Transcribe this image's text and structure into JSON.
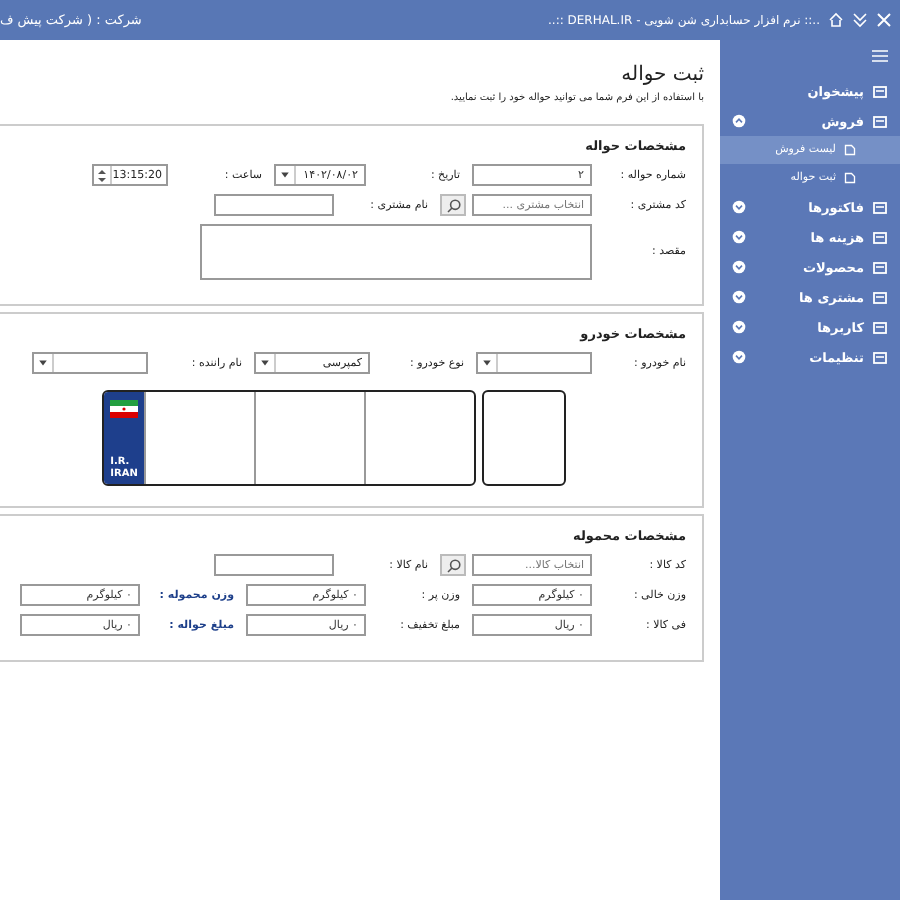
{
  "title_bar": {
    "app_title": "..:: نرم افزار حسابداری شن شویی - DERHAL.IR ::..",
    "company": "شرکت : ( شرکت پیش ف"
  },
  "page": {
    "title": "ثبت حواله",
    "subtitle": "با استفاده از این فرم شما می توانید حواله خود را ثبت نمایید."
  },
  "sections": [
    {
      "title": "مشخصات حواله",
      "rows": [
        [
          {
            "label": "شماره حواله :",
            "kind": "input",
            "value": "۲",
            "highlighted": false
          },
          {
            "label": "تاریخ :",
            "kind": "date",
            "value": "۱۴۰۲/۰۸/۰۲",
            "highlighted": false
          },
          {
            "label": "ساعت :",
            "kind": "time",
            "value": "13:15:20",
            "highlighted": false
          }
        ],
        [
          {
            "label": "کد مشتری :",
            "kind": "lookup",
            "placeholder": "انتخاب مشتری ...",
            "highlighted": false
          },
          {
            "label": "نام مشتری :",
            "kind": "input",
            "highlighted": false
          }
        ],
        [
          {
            "label": "مقصد :",
            "kind": "textarea",
            "highlighted": false
          }
        ]
      ]
    },
    {
      "title": "مشخصات خودرو",
      "rows": [
        [
          {
            "label": "نام خودرو :",
            "kind": "select",
            "highlighted": false
          },
          {
            "label": "نوع خودرو :",
            "kind": "select",
            "value": "کمپرسی",
            "highlighted": false
          },
          {
            "label": "نام راننده :",
            "kind": "select",
            "highlighted": false
          }
        ]
      ],
      "plate": {
        "country_lines": [
          "I.R.",
          "IRAN"
        ]
      }
    },
    {
      "title": "مشخصات محموله",
      "rows": [
        [
          {
            "label": "کد کالا :",
            "kind": "lookup",
            "placeholder": "انتخاب کالا...",
            "highlighted": false
          },
          {
            "label": "نام کالا :",
            "kind": "input",
            "highlighted": false
          }
        ],
        [
          {
            "label": "وزن خالی :",
            "kind": "input",
            "value": "۰ کیلوگرم",
            "highlighted": false
          },
          {
            "label": "وزن پر :",
            "kind": "input",
            "value": "۰ کیلوگرم",
            "highlighted": false
          },
          {
            "label": "وزن محموله :",
            "kind": "input",
            "value": "۰ کیلوگرم",
            "highlighted": true
          }
        ],
        [
          {
            "label": "فی کالا :",
            "kind": "input",
            "value": "۰ ریال",
            "highlighted": false
          },
          {
            "label": "مبلغ تخفیف :",
            "kind": "input",
            "value": "۰ ریال",
            "highlighted": false
          },
          {
            "label": "مبلغ حواله :",
            "kind": "input",
            "value": "۰ ریال",
            "highlighted": true
          }
        ]
      ]
    }
  ],
  "sidebar": {
    "items": [
      {
        "label": "پیشخوان",
        "kind": "link",
        "selected": false
      },
      {
        "label": "فروش",
        "kind": "group",
        "expanded": true,
        "selected": false,
        "children": [
          {
            "label": "لیست فروش",
            "selected": true
          },
          {
            "label": "ثبت حواله",
            "selected": false
          }
        ]
      },
      {
        "label": "فاکتورها",
        "kind": "group",
        "expanded": false,
        "selected": false
      },
      {
        "label": "هزینه ها",
        "kind": "group",
        "expanded": false,
        "selected": false
      },
      {
        "label": "محصولات",
        "kind": "group",
        "expanded": false,
        "selected": false
      },
      {
        "label": "مشتری ها",
        "kind": "group",
        "expanded": false,
        "selected": false
      },
      {
        "label": "کاربرها",
        "kind": "group",
        "expanded": false,
        "selected": false
      },
      {
        "label": "تنظیمات",
        "kind": "group",
        "expanded": false,
        "selected": false
      }
    ]
  }
}
